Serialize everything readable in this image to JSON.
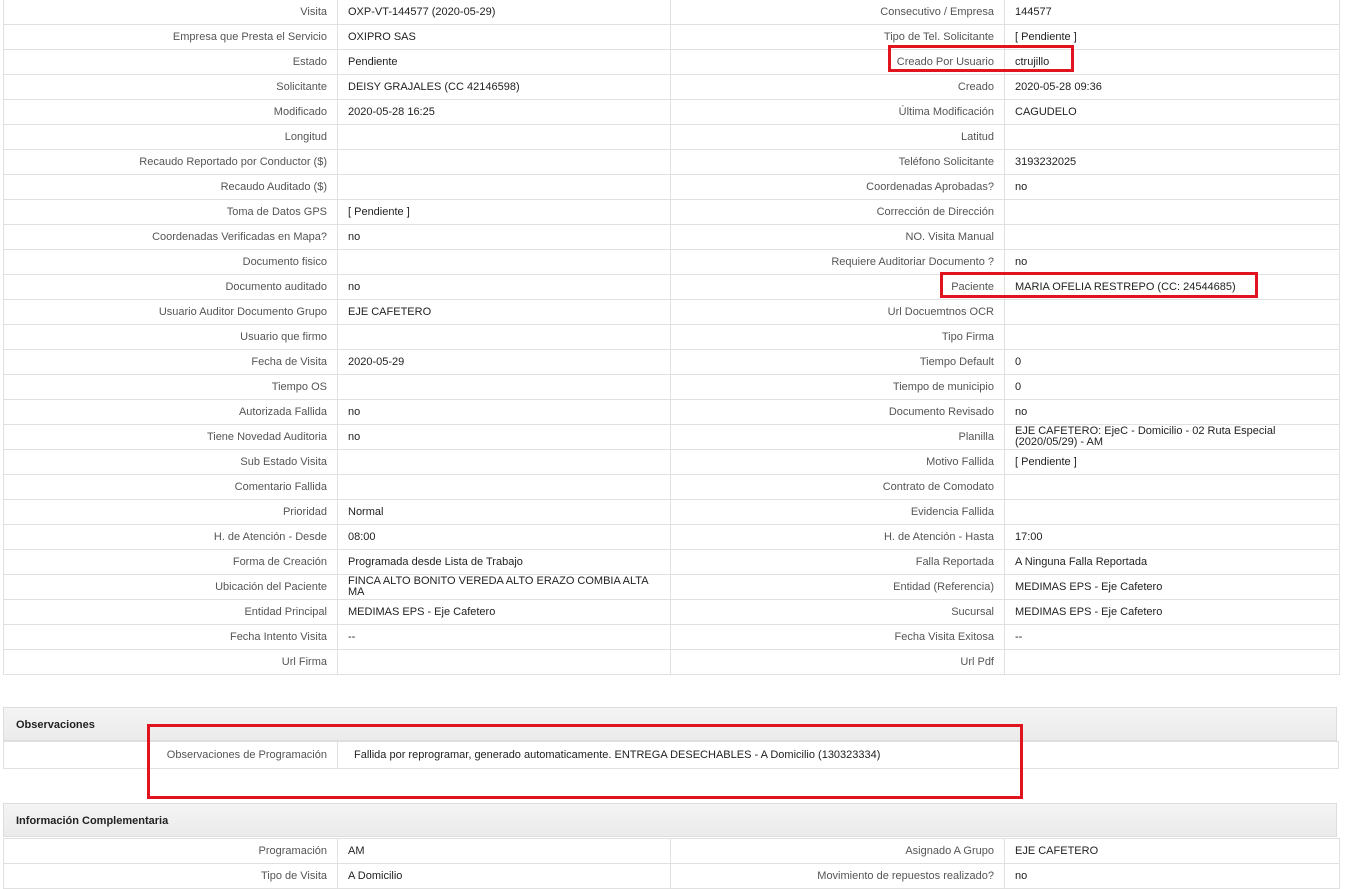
{
  "main_rows": [
    [
      "Visita",
      "OXP-VT-144577 (2020-05-29)",
      "Consecutivo / Empresa",
      "144577"
    ],
    [
      "Empresa que Presta el Servicio",
      "OXIPRO SAS",
      "Tipo de Tel. Solicitante",
      "[ Pendiente ]"
    ],
    [
      "Estado",
      "Pendiente",
      "Creado Por Usuario",
      "ctrujillo"
    ],
    [
      "Solicitante",
      "DEISY GRAJALES (CC 42146598)",
      "Creado",
      "2020-05-28 09:36"
    ],
    [
      "Modificado",
      "2020-05-28 16:25",
      "Última Modificación",
      "CAGUDELO"
    ],
    [
      "Longitud",
      "",
      "Latitud",
      ""
    ],
    [
      "Recaudo Reportado por Conductor ($)",
      "",
      "Teléfono Solicitante",
      "3193232025"
    ],
    [
      "Recaudo Auditado ($)",
      "",
      "Coordenadas Aprobadas?",
      "no"
    ],
    [
      "Toma de Datos GPS",
      "[ Pendiente ]",
      "Corrección de Dirección",
      ""
    ],
    [
      "Coordenadas Verificadas en Mapa?",
      "no",
      "NO. Visita Manual",
      ""
    ],
    [
      "Documento fisico",
      "",
      "Requiere Auditoriar Documento ?",
      "no"
    ],
    [
      "Documento auditado",
      "no",
      "Paciente",
      "MARIA OFELIA RESTREPO (CC: 24544685)"
    ],
    [
      "Usuario Auditor Documento Grupo",
      "EJE CAFETERO",
      "Url Docuemtnos OCR",
      ""
    ],
    [
      "Usuario que firmo",
      "",
      "Tipo Firma",
      ""
    ],
    [
      "Fecha de Visita",
      "2020-05-29",
      "Tiempo Default",
      "0"
    ],
    [
      "Tiempo OS",
      "",
      "Tiempo de municipio",
      "0"
    ],
    [
      "Autorizada Fallida",
      "no",
      "Documento Revisado",
      "no"
    ],
    [
      "Tiene Novedad Auditoria",
      "no",
      "Planilla",
      "EJE CAFETERO: EjeC - Domicilio - 02 Ruta Especial (2020/05/29) - AM"
    ],
    [
      "Sub Estado Visita",
      "",
      "Motivo Fallida",
      "[ Pendiente ]"
    ],
    [
      "Comentario Fallida",
      "",
      "Contrato de Comodato",
      ""
    ],
    [
      "Prioridad",
      "Normal",
      "Evidencia Fallida",
      ""
    ],
    [
      "H. de Atención - Desde",
      "08:00",
      "H. de Atención - Hasta",
      "17:00"
    ],
    [
      "Forma de Creación",
      "Programada desde Lista de Trabajo",
      "Falla Reportada",
      "A Ninguna Falla Reportada"
    ],
    [
      "Ubicación del Paciente",
      "FINCA ALTO BONITO VEREDA ALTO ERAZO COMBIA ALTA MA",
      "Entidad (Referencia)",
      "MEDIMAS EPS - Eje Cafetero"
    ],
    [
      "Entidad Principal",
      "MEDIMAS EPS - Eje Cafetero",
      "Sucursal",
      "MEDIMAS EPS - Eje Cafetero"
    ],
    [
      "Fecha Intento Visita",
      "--",
      "Fecha Visita Exitosa",
      "--"
    ],
    [
      "Url Firma",
      "",
      "Url Pdf",
      ""
    ]
  ],
  "observaciones": {
    "title": "Observaciones",
    "label": "Observaciones de Programación",
    "value": "Fallida por reprogramar, generado automaticamente. ENTREGA DESECHABLES - A Domicilio (130323334)"
  },
  "complementaria": {
    "title": "Información Complementaria",
    "rows": [
      [
        "Programación",
        "AM",
        "Asignado A Grupo",
        "EJE CAFETERO"
      ],
      [
        "Tipo de Visita",
        "A Domicilio",
        "Movimiento de repuestos realizado?",
        "no"
      ]
    ]
  },
  "colors": {
    "highlight": "#e0141e",
    "border": "#e0e0e0",
    "header_bg": "#eeeeee"
  }
}
